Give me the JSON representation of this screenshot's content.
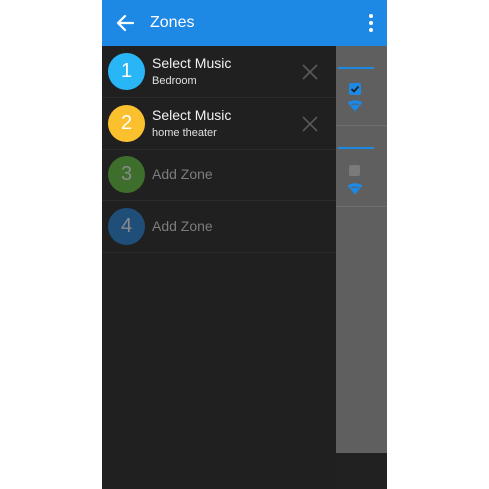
{
  "appbar": {
    "title": "Zones",
    "background": "#1e88e5",
    "back_icon": "arrow-left-icon",
    "menu_icon": "more-vertical-icon"
  },
  "zones": [
    {
      "number": "1",
      "title": "Select Music",
      "subtitle": "Bedroom",
      "color": "#29b6f6",
      "state": "assigned",
      "remove_icon": "close-icon"
    },
    {
      "number": "2",
      "title": "Select Music",
      "subtitle": "home theater",
      "color": "#fbc02d",
      "state": "assigned",
      "remove_icon": "close-icon"
    },
    {
      "number": "3",
      "title": "Add Zone",
      "color": "#3d6e2b",
      "state": "empty"
    },
    {
      "number": "4",
      "title": "Add Zone",
      "color": "#1f4e79",
      "state": "empty"
    }
  ],
  "background_icons": [
    "checkbox-checked-icon",
    "wifi-icon",
    "checkbox-icon",
    "wifi-icon"
  ]
}
